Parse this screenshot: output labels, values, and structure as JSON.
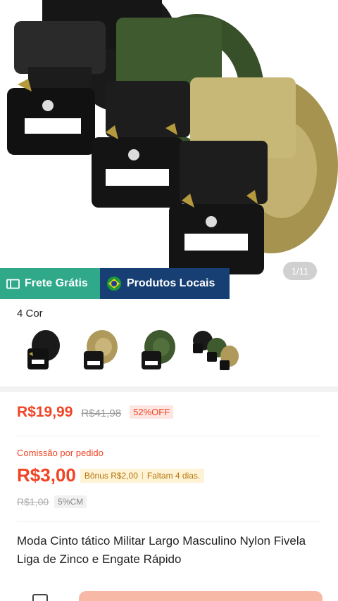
{
  "gallery": {
    "counter": "1/11"
  },
  "badges": {
    "free_shipping": "Frete Grátis",
    "local_products": "Produtos Locais"
  },
  "colors": {
    "label": "4 Cor",
    "swatches": [
      "black-belt",
      "khaki-belt",
      "green-belt",
      "multi-pack-belts"
    ]
  },
  "price": {
    "current": "R$19,99",
    "original": "R$41,98",
    "discount": "52%OFF"
  },
  "commission": {
    "label": "Comissão por pedido",
    "value": "R$3,00",
    "bonus": "Bônus R$2,00",
    "remaining": "Faltam 4 dias.",
    "old_value": "R$1,00",
    "rate": "5%CM"
  },
  "product": {
    "title": "Moda Cinto tático Militar Largo Masculino Nylon Fivela Liga de Zinco e Engate Rápido"
  },
  "theme": {
    "accent": "#f04424",
    "free_shipping_bg": "#2fa98a",
    "local_bg": "#173f74",
    "bonus_bg": "#fff3d6"
  }
}
